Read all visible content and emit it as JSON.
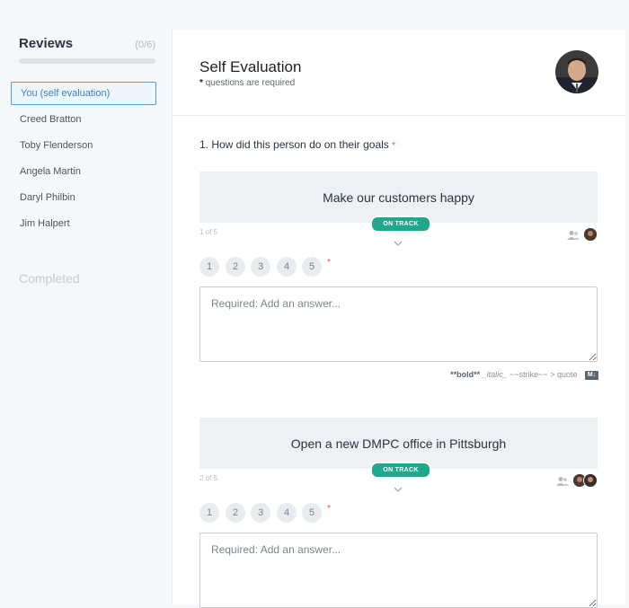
{
  "sidebar": {
    "title": "Reviews",
    "count": "(0/6)",
    "progress": 0,
    "items": [
      {
        "label": "You (self evaluation)",
        "active": true
      },
      {
        "label": "Creed Bratton"
      },
      {
        "label": "Toby Flenderson"
      },
      {
        "label": "Angela Martin"
      },
      {
        "label": "Daryl Philbin"
      },
      {
        "label": "Jim Halpert"
      }
    ],
    "completed_heading": "Completed"
  },
  "header": {
    "title": "Self Evaluation",
    "required_star": "*",
    "required_note": "questions are required"
  },
  "question": {
    "number_title": "1. How did this person do on their goals",
    "required_star": "*"
  },
  "goals": [
    {
      "title": "Make our customers happy",
      "index": "1 of 5",
      "status": "ON TRACK",
      "ratings": [
        "1",
        "2",
        "3",
        "4",
        "5"
      ],
      "answer_placeholder": "Required: Add an answer..."
    },
    {
      "title": "Open a new DMPC office in Pittsburgh",
      "index": "2 of 5",
      "status": "ON TRACK",
      "ratings": [
        "1",
        "2",
        "3",
        "4",
        "5"
      ],
      "answer_placeholder": "Required: Add an answer..."
    }
  ],
  "markdown_hint": {
    "bold": "**bold**",
    "italic": "_italic_",
    "strike": "~~strike~~",
    "quote": "> quote",
    "icon_label": "M↓"
  },
  "colors": {
    "accent": "#3b82c4",
    "status_green": "#20a88c",
    "required_red": "#e55353"
  },
  "icons": [
    "people-icon",
    "chevron-down-icon",
    "markdown-icon"
  ]
}
